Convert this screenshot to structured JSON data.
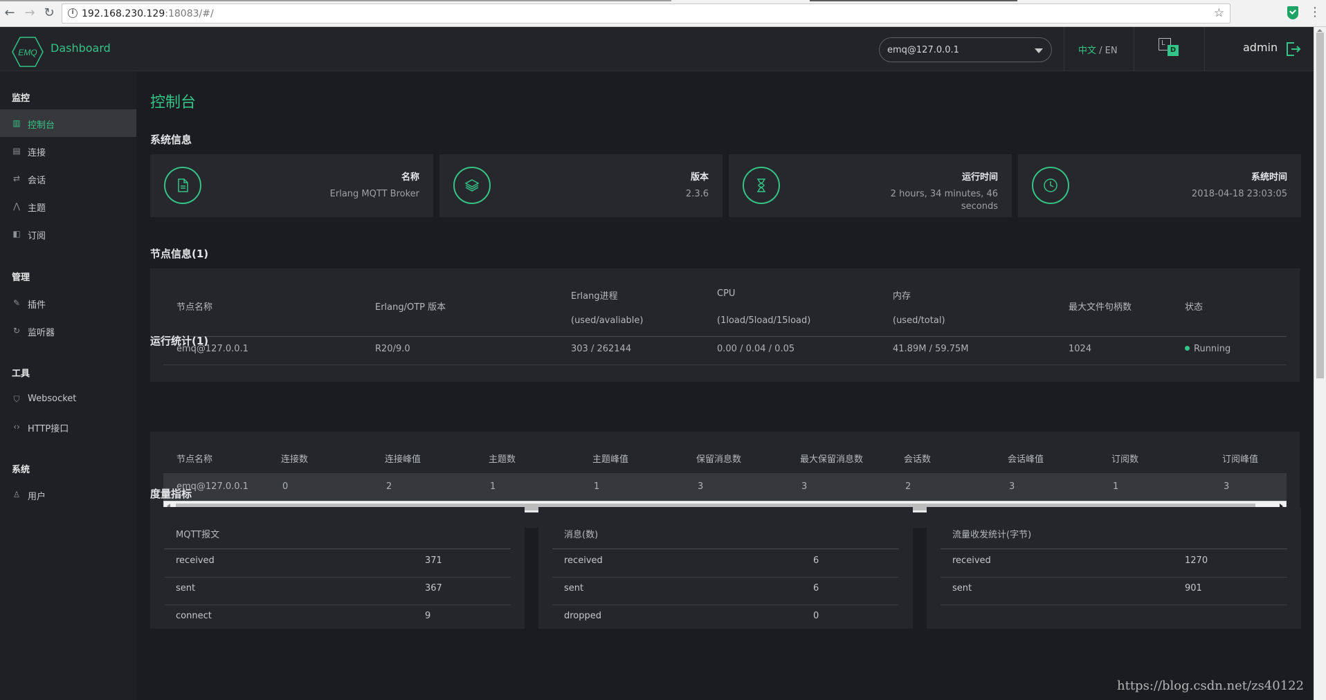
{
  "browser": {
    "url_host": "192.168.230.129",
    "url_rest": ":18083/#/"
  },
  "header": {
    "brand_logo_text": "EMQ",
    "brand": "Dashboard",
    "node_select": "emq@127.0.0.1",
    "lang_zh": "中文",
    "lang_sep": " / ",
    "lang_en": "EN",
    "ld_l": "L",
    "ld_d": "D",
    "user": "admin"
  },
  "sidebar": {
    "groups": [
      {
        "title": "监控",
        "items": [
          {
            "label": "控制台",
            "icon": "bar-chart-icon",
            "active": true
          },
          {
            "label": "连接",
            "icon": "database-icon"
          },
          {
            "label": "会话",
            "icon": "swap-icon"
          },
          {
            "label": "主题",
            "icon": "branch-icon"
          },
          {
            "label": "订阅",
            "icon": "rss-icon"
          }
        ]
      },
      {
        "title": "管理",
        "items": [
          {
            "label": "插件",
            "icon": "plug-icon"
          },
          {
            "label": "监听器",
            "icon": "listener-icon"
          }
        ]
      },
      {
        "title": "工具",
        "items": [
          {
            "label": "Websocket",
            "icon": "html5-icon"
          },
          {
            "label": "HTTP接口",
            "icon": "code-icon"
          }
        ]
      },
      {
        "title": "系统",
        "items": [
          {
            "label": "用户",
            "icon": "user-icon"
          }
        ]
      }
    ]
  },
  "page": {
    "title": "控制台",
    "system_info_title": "系统信息",
    "cards": [
      {
        "title": "名称",
        "value": "Erlang MQTT Broker",
        "icon": "document-icon"
      },
      {
        "title": "版本",
        "value": "2.3.6",
        "icon": "layers-icon"
      },
      {
        "title": "运行时间",
        "value": "2 hours, 34 minutes, 46 seconds",
        "icon": "hourglass-icon"
      },
      {
        "title": "系统时间",
        "value": "2018-04-18 23:03:05",
        "icon": "clock-icon"
      }
    ],
    "nodes_title": "节点信息(1)",
    "nodes_headers": {
      "name": "节点名称",
      "otp": "Erlang/OTP 版本",
      "proc1": "Erlang进程",
      "proc2": "(used/avaliable)",
      "cpu1": "CPU",
      "cpu2": "(1load/5load/15load)",
      "mem1": "内存",
      "mem2": "(used/total)",
      "fd": "最大文件句柄数",
      "status": "状态"
    },
    "nodes_row": {
      "name": "emq@127.0.0.1",
      "otp": "R20/9.0",
      "proc": "303 / 262144",
      "cpu": "0.00 / 0.04 / 0.05",
      "mem": "41.89M / 59.75M",
      "fd": "1024",
      "status": "Running"
    },
    "stats_title": "运行统计(1)",
    "stats_headers": [
      "节点名称",
      "连接数",
      "连接峰值",
      "主题数",
      "主题峰值",
      "保留消息数",
      "最大保留消息数",
      "会话数",
      "会话峰值",
      "订阅数",
      "订阅峰值"
    ],
    "stats_row": [
      "emq@127.0.0.1",
      "0",
      "2",
      "1",
      "1",
      "3",
      "3",
      "2",
      "3",
      "1",
      "3"
    ],
    "metrics_title": "度量指标",
    "metrics": [
      {
        "title": "MQTT报文",
        "rows": [
          [
            "received",
            "371"
          ],
          [
            "sent",
            "367"
          ],
          [
            "connect",
            "9"
          ]
        ]
      },
      {
        "title": "消息(数)",
        "rows": [
          [
            "received",
            "6"
          ],
          [
            "sent",
            "6"
          ],
          [
            "dropped",
            "0"
          ]
        ]
      },
      {
        "title": "流量收发统计(字节)",
        "rows": [
          [
            "received",
            "1270"
          ],
          [
            "sent",
            "901"
          ]
        ]
      }
    ]
  },
  "watermark": "https://blog.csdn.net/zs40122",
  "colors": {
    "accent": "#34c388",
    "bg": "#1b1c1f",
    "panel": "#25262a",
    "sidebar": "#1f2023"
  }
}
